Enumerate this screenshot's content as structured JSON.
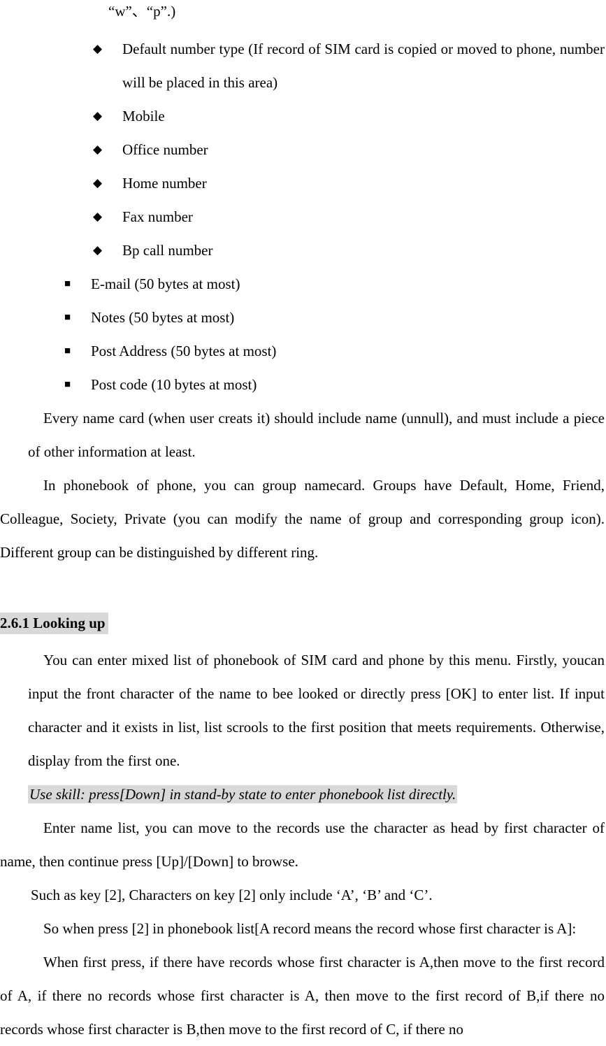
{
  "document": {
    "type": "user-manual-page",
    "language": "en",
    "highlight_color": "#d9d9d9",
    "text_color": "#000000",
    "background_color": "#ffffff"
  },
  "top_fragment": {
    "text": "“w”、“p”.)"
  },
  "number_type_list": {
    "bullet_glyph": "◆",
    "bullet_name": "diamond-bullet-icon",
    "items": [
      {
        "text": "Default number type (If record of SIM card is copied or moved to phone, number will be placed in this area)"
      },
      {
        "text": "Mobile"
      },
      {
        "text": "Office number"
      },
      {
        "text": "Home number"
      },
      {
        "text": "Fax number"
      },
      {
        "text": "Bp call number"
      }
    ]
  },
  "field_list": {
    "bullet_glyph": "■",
    "bullet_name": "square-bullet-icon",
    "items": [
      {
        "text": "E-mail (50 bytes at most)"
      },
      {
        "text": "Notes (50 bytes at most)"
      },
      {
        "text": "Post Address (50 bytes at most)"
      },
      {
        "text": "Post code (10 bytes at most)"
      }
    ]
  },
  "paragraphs": {
    "namecard_rule": "Every name card (when user creats it) should include name (unnull), and must include a piece of other information at least.",
    "grouping": "In phonebook of phone, you can group namecard. Groups have Default, Home, Friend, Colleague, Society, Private (you can modify the name of group and corresponding group icon). Different group can be distinguished by different ring."
  },
  "section": {
    "heading": "2.6.1 Looking up",
    "intro": "You can enter mixed list of phonebook of SIM card and phone by this menu. Firstly, youcan input the front character of the name to bee looked or directly press [OK] to enter list. If input character and it exists in list, list scrools to the first position that meets requirements. Otherwise, display from the first one.",
    "tip": "Use skill: press[Down] in stand-by state to enter phonebook list directly.",
    "browse": "Enter name list, you can move to the records use the character as head by first character of name, then continue press [Up]/[Down] to browse.",
    "key_example": "Such as key [2], Characters on key [2] only include ‘A’, ‘B’ and ‘C’.",
    "key_press_intro": "So when press [2] in phonebook list[A record means the record whose first character is A]:",
    "first_press": "When first press, if there have records whose first character is A,then move to the first record of A, if there no records whose first character is A, then move to the first record of B,if there no records whose first character is B,then move to the first record of C, if there no"
  }
}
